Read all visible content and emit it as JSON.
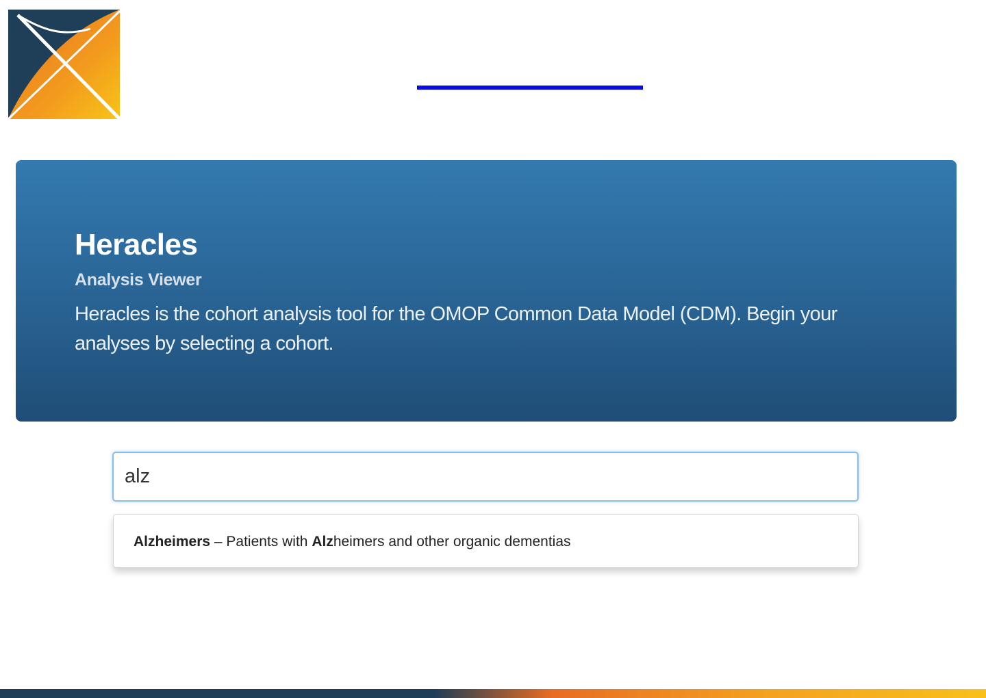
{
  "header": {
    "logo_icon": "ohdsi-logo-icon",
    "title_link_text": ""
  },
  "jumbotron": {
    "title": "Heracles",
    "subtitle": "Analysis Viewer",
    "description": "Heracles is the cohort analysis tool for the OMOP Common Data Model (CDM). Begin your analyses by selecting a cohort."
  },
  "search": {
    "value": "alz"
  },
  "suggestions": [
    {
      "name": "Alzheimers",
      "separator": " – ",
      "description_prefix": "Patients with ",
      "description_match": "Alz",
      "description_rest": "heimers and other organic dementias"
    }
  ],
  "colors": {
    "jumbotron_top": "#337ab0",
    "jumbotron_bottom": "#1f4e77",
    "link_underline": "#0a0ae6",
    "input_focus": "#8cbde8",
    "footer_dark": "#1e3d57",
    "footer_orange": "#e86c22",
    "footer_yellow": "#f8c01a"
  }
}
